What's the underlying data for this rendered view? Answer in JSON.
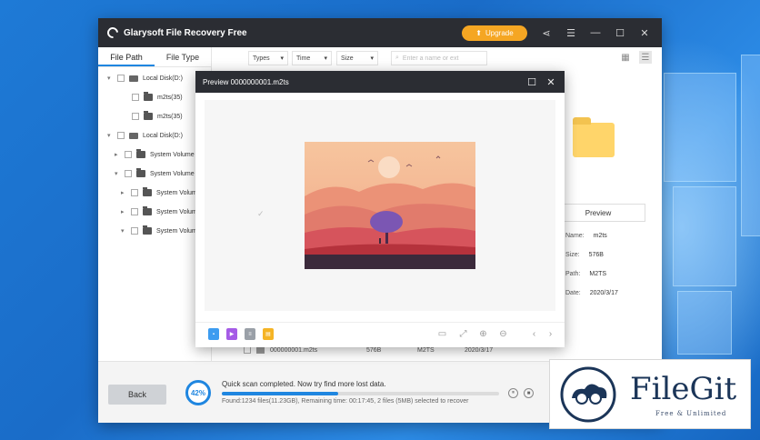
{
  "app": {
    "title": "Glarysoft File Recovery Free",
    "upgrade_label": "Upgrade",
    "accent_color": "#1f86e0",
    "upgrade_color": "#f5a623"
  },
  "left_panel": {
    "tabs": [
      {
        "label": "File Path",
        "active": true
      },
      {
        "label": "File Type",
        "active": false
      }
    ],
    "tree": [
      {
        "label": "Local Disk(D:)",
        "icon": "disk-icon",
        "expanded": true
      },
      {
        "label": "m2ts(35)",
        "icon": "folder-icon"
      },
      {
        "label": "m2ts(35)",
        "icon": "folder-icon"
      },
      {
        "label": "Local Disk(D:)",
        "icon": "disk-icon",
        "expanded": true
      },
      {
        "label": "System Volume",
        "icon": "folder-icon",
        "expanded": false
      },
      {
        "label": "System Volume",
        "icon": "folder-icon",
        "expanded": true
      },
      {
        "label": "System Volum",
        "icon": "folder-icon",
        "expanded": false
      },
      {
        "label": "System Volum",
        "icon": "folder-icon",
        "expanded": false
      },
      {
        "label": "System Volum",
        "icon": "folder-icon",
        "expanded": true
      }
    ]
  },
  "toolbar": {
    "filters": [
      "Types",
      "Time",
      "Size"
    ],
    "search_placeholder": "Enter a name or ext"
  },
  "details": {
    "preview_label": "Preview",
    "fields": [
      {
        "label": "Name:",
        "value": "m2ts"
      },
      {
        "label": "Size:",
        "value": "576B"
      },
      {
        "label": "Path:",
        "value": "M2TS"
      },
      {
        "label": "Date:",
        "value": "2020/3/17"
      }
    ]
  },
  "list_row": {
    "name": "000000001.m2ts",
    "size": "576B",
    "type": "M2TS",
    "date": "2020/3/17"
  },
  "preview_dialog": {
    "title": "Preview 0000000001.m2ts",
    "file_icons": [
      "image-file-icon",
      "video-file-icon",
      "doc-file-icon",
      "zip-file-icon"
    ],
    "file_icon_colors": [
      "#3d9cf0",
      "#a55be6",
      "#9aa0a8",
      "#f5b425"
    ]
  },
  "bottom": {
    "back_label": "Back",
    "progress_text": "42%",
    "progress_value": 0.42,
    "status": "Quick scan completed. Now try find more lost data.",
    "found": "Found:1234 files(11.23GB), Remaining time: 00:17:45, 2 files (5MB) selected to recover"
  },
  "watermark": {
    "name": "FileGit",
    "tagline": "Free & Unlimited"
  }
}
